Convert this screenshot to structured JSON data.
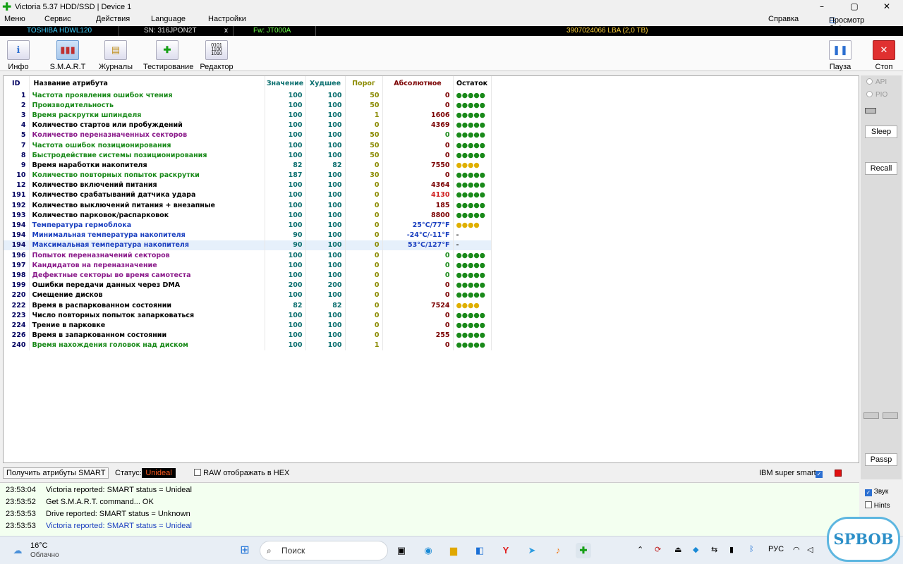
{
  "window": {
    "title": "Victoria 5.37 HDD/SSD | Device 1"
  },
  "menu": {
    "items": [
      "Меню",
      "Сервис",
      "Действия",
      "Language",
      "Настройки"
    ],
    "help": "Справка",
    "clipboard": "Просмотр буфера"
  },
  "device": {
    "model": "TOSHIBA HDWL120",
    "serial": "SN: 316JPON2T",
    "close": "x",
    "firmware": "Fw: JT000A",
    "capacity": "3907024066 LBA (2,0 TB)"
  },
  "toolbar": {
    "buttons": [
      "Инфо",
      "S.M.A.R.T",
      "Журналы",
      "Тестирование",
      "Редактор"
    ],
    "pause": "Пауза",
    "stop": "Стоп"
  },
  "smart_table": {
    "headers": [
      "ID",
      "Название атрибута",
      "Значение",
      "Худшее",
      "Порог",
      "Абсолютное",
      "Остаток"
    ],
    "rows": [
      {
        "id": "1",
        "name": "Частота проявления ошибок чтения",
        "value": "100",
        "worst": "100",
        "threshold": "50",
        "raw": "0",
        "rest": "●●●●●",
        "name_color": "#1a8a1a",
        "rest_color": "#1a8a1a",
        "raw_color": "#7a0000"
      },
      {
        "id": "2",
        "name": "Производительность",
        "value": "100",
        "worst": "100",
        "threshold": "50",
        "raw": "0",
        "rest": "●●●●●",
        "name_color": "#1a8a1a",
        "rest_color": "#1a8a1a",
        "raw_color": "#7a0000"
      },
      {
        "id": "3",
        "name": "Время раскрутки шпинделя",
        "value": "100",
        "worst": "100",
        "threshold": "1",
        "raw": "1606",
        "rest": "●●●●●",
        "name_color": "#1a8a1a",
        "rest_color": "#1a8a1a",
        "raw_color": "#7a0000"
      },
      {
        "id": "4",
        "name": "Количество стартов или пробуждений",
        "value": "100",
        "worst": "100",
        "threshold": "0",
        "raw": "4369",
        "rest": "●●●●●",
        "name_color": "#000000",
        "rest_color": "#1a8a1a",
        "raw_color": "#7a0000"
      },
      {
        "id": "5",
        "name": "Количество переназначенных секторов",
        "value": "100",
        "worst": "100",
        "threshold": "50",
        "raw": "0",
        "rest": "●●●●●",
        "name_color": "#8a1a8a",
        "rest_color": "#1a8a1a",
        "raw_color": "#1a8a1a"
      },
      {
        "id": "7",
        "name": "Частота ошибок позиционирования",
        "value": "100",
        "worst": "100",
        "threshold": "50",
        "raw": "0",
        "rest": "●●●●●",
        "name_color": "#1a8a1a",
        "rest_color": "#1a8a1a",
        "raw_color": "#7a0000"
      },
      {
        "id": "8",
        "name": "Быстродействие системы позиционирования",
        "value": "100",
        "worst": "100",
        "threshold": "50",
        "raw": "0",
        "rest": "●●●●●",
        "name_color": "#1a8a1a",
        "rest_color": "#1a8a1a",
        "raw_color": "#7a0000"
      },
      {
        "id": "9",
        "name": "Время наработки накопителя",
        "value": "82",
        "worst": "82",
        "threshold": "0",
        "raw": "7550",
        "rest": "●●●●",
        "name_color": "#000000",
        "rest_color": "#e0b000",
        "raw_color": "#7a0000"
      },
      {
        "id": "10",
        "name": "Количество повторных попыток раскрутки",
        "value": "187",
        "worst": "100",
        "threshold": "30",
        "raw": "0",
        "rest": "●●●●●",
        "name_color": "#1a8a1a",
        "rest_color": "#1a8a1a",
        "raw_color": "#7a0000"
      },
      {
        "id": "12",
        "name": "Количество включений питания",
        "value": "100",
        "worst": "100",
        "threshold": "0",
        "raw": "4364",
        "rest": "●●●●●",
        "name_color": "#000000",
        "rest_color": "#1a8a1a",
        "raw_color": "#7a0000"
      },
      {
        "id": "191",
        "name": "Количество срабатываний датчика удара",
        "value": "100",
        "worst": "100",
        "threshold": "0",
        "raw": "4130",
        "rest": "●●●●●",
        "name_color": "#000000",
        "rest_color": "#1a8a1a",
        "raw_color": "#d02020"
      },
      {
        "id": "192",
        "name": "Количество выключений питания + внезапные",
        "value": "100",
        "worst": "100",
        "threshold": "0",
        "raw": "185",
        "rest": "●●●●●",
        "name_color": "#000000",
        "rest_color": "#1a8a1a",
        "raw_color": "#7a0000"
      },
      {
        "id": "193",
        "name": "Количество парковок/распарковок",
        "value": "100",
        "worst": "100",
        "threshold": "0",
        "raw": "8800",
        "rest": "●●●●●",
        "name_color": "#000000",
        "rest_color": "#1a8a1a",
        "raw_color": "#7a0000"
      },
      {
        "id": "194",
        "name": "Температура гермоблока",
        "value": "100",
        "worst": "100",
        "threshold": "0",
        "raw": "25°C/77°F",
        "rest": "●●●●",
        "name_color": "#1a3fbf",
        "rest_color": "#e0b000",
        "raw_color": "#1a3fbf"
      },
      {
        "id": "194",
        "name": "Минимальная температура накопителя",
        "value": "90",
        "worst": "100",
        "threshold": "0",
        "raw": "-24°C/-11°F",
        "rest": "-",
        "name_color": "#1a3fbf",
        "rest_color": "#333333",
        "raw_color": "#1a3fbf"
      },
      {
        "id": "194",
        "name": "Максимальная температура накопителя",
        "value": "90",
        "worst": "100",
        "threshold": "0",
        "raw": "53°C/127°F",
        "rest": "-",
        "name_color": "#1a3fbf",
        "rest_color": "#333333",
        "raw_color": "#1a3fbf"
      },
      {
        "id": "196",
        "name": "Попыток переназначений секторов",
        "value": "100",
        "worst": "100",
        "threshold": "0",
        "raw": "0",
        "rest": "●●●●●",
        "name_color": "#8a1a8a",
        "rest_color": "#1a8a1a",
        "raw_color": "#1a8a1a"
      },
      {
        "id": "197",
        "name": "Кандидатов на переназначение",
        "value": "100",
        "worst": "100",
        "threshold": "0",
        "raw": "0",
        "rest": "●●●●●",
        "name_color": "#8a1a8a",
        "rest_color": "#1a8a1a",
        "raw_color": "#1a8a1a"
      },
      {
        "id": "198",
        "name": "Дефектные секторы во время самотеста",
        "value": "100",
        "worst": "100",
        "threshold": "0",
        "raw": "0",
        "rest": "●●●●●",
        "name_color": "#8a1a8a",
        "rest_color": "#1a8a1a",
        "raw_color": "#1a8a1a"
      },
      {
        "id": "199",
        "name": "Ошибки передачи данных через DMA",
        "value": "200",
        "worst": "200",
        "threshold": "0",
        "raw": "0",
        "rest": "●●●●●",
        "name_color": "#000000",
        "rest_color": "#1a8a1a",
        "raw_color": "#7a0000"
      },
      {
        "id": "220",
        "name": "Смещение дисков",
        "value": "100",
        "worst": "100",
        "threshold": "0",
        "raw": "0",
        "rest": "●●●●●",
        "name_color": "#000000",
        "rest_color": "#1a8a1a",
        "raw_color": "#7a0000"
      },
      {
        "id": "222",
        "name": "Время в распаркованном состоянии",
        "value": "82",
        "worst": "82",
        "threshold": "0",
        "raw": "7524",
        "rest": "●●●●",
        "name_color": "#000000",
        "rest_color": "#e0b000",
        "raw_color": "#7a0000"
      },
      {
        "id": "223",
        "name": "Число повторных попыток запарковаться",
        "value": "100",
        "worst": "100",
        "threshold": "0",
        "raw": "0",
        "rest": "●●●●●",
        "name_color": "#000000",
        "rest_color": "#1a8a1a",
        "raw_color": "#7a0000"
      },
      {
        "id": "224",
        "name": "Трение в парковке",
        "value": "100",
        "worst": "100",
        "threshold": "0",
        "raw": "0",
        "rest": "●●●●●",
        "name_color": "#000000",
        "rest_color": "#1a8a1a",
        "raw_color": "#7a0000"
      },
      {
        "id": "226",
        "name": "Время в запаркованном состоянии",
        "value": "100",
        "worst": "100",
        "threshold": "0",
        "raw": "255",
        "rest": "●●●●●",
        "name_color": "#000000",
        "rest_color": "#1a8a1a",
        "raw_color": "#7a0000"
      },
      {
        "id": "240",
        "name": "Время нахождения головок над диском",
        "value": "100",
        "worst": "100",
        "threshold": "1",
        "raw": "0",
        "rest": "●●●●●",
        "name_color": "#1a8a1a",
        "rest_color": "#1a8a1a",
        "raw_color": "#7a0000"
      }
    ]
  },
  "right_panel": {
    "api": "API",
    "pio": "PIO",
    "sleep": "Sleep",
    "recall": "Recall",
    "passp": "Passp"
  },
  "status": {
    "get_smart": "Получить атрибуты SMART",
    "status_label": "Статус:",
    "status_value": "Unideal",
    "raw_hex": "RAW отображать в HEX",
    "ibm": "IBM super smart:"
  },
  "log": [
    {
      "time": "23:53:04",
      "msg": "Victoria reported: SMART status = Unideal",
      "blue": false
    },
    {
      "time": "23:53:52",
      "msg": "Get S.M.A.R.T. command... OK",
      "blue": false
    },
    {
      "time": "23:53:53",
      "msg": "Drive reported: SMART status = Unknown",
      "blue": false
    },
    {
      "time": "23:53:53",
      "msg": "Victoria reported: SMART status = Unideal",
      "blue": true
    }
  ],
  "log_options": {
    "sound": "Звук",
    "hints": "Hints"
  },
  "taskbar": {
    "weather_temp": "16°C",
    "weather_desc": "Облачно",
    "search": "Поиск",
    "lang": "РУС"
  },
  "watermark": "SPBOB",
  "colors": {
    "accent": "#2c6fd1",
    "status_bg": "#000000",
    "status_fg": "#ff5a1e",
    "log_bg": "#f3fff0"
  }
}
